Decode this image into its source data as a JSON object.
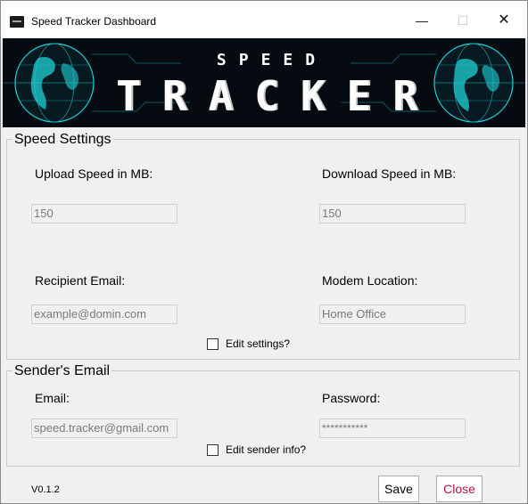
{
  "window": {
    "title": "Speed Tracker Dashboard",
    "controls": {
      "minimize": "—",
      "maximize": "☐",
      "close": "✕"
    }
  },
  "banner": {
    "subtitle": "SPEED",
    "title": "TRACKER",
    "colors": {
      "background": "#050b10",
      "globe": "#1fd1d6",
      "text": "#ffffff"
    }
  },
  "speed_settings": {
    "title": "Speed Settings",
    "upload_label": "Upload Speed in MB:",
    "upload_value": "150",
    "download_label": "Download Speed in MB:",
    "download_value": "150",
    "recipient_label": "Recipient Email:",
    "recipient_placeholder": "example@domin.com",
    "modem_label": "Modem Location:",
    "modem_value": "Home Office",
    "edit_checkbox_label": "Edit settings?",
    "edit_checked": false
  },
  "sender_email": {
    "title": "Sender's Email",
    "email_label": "Email:",
    "email_value": "speed.tracker@gmail.com",
    "password_label": "Password:",
    "password_value": "***********",
    "edit_checkbox_label": "Edit sender info?",
    "edit_checked": false
  },
  "footer": {
    "version": "V0.1.2",
    "save_label": "Save",
    "close_label": "Close",
    "close_color": "#b3123f"
  }
}
